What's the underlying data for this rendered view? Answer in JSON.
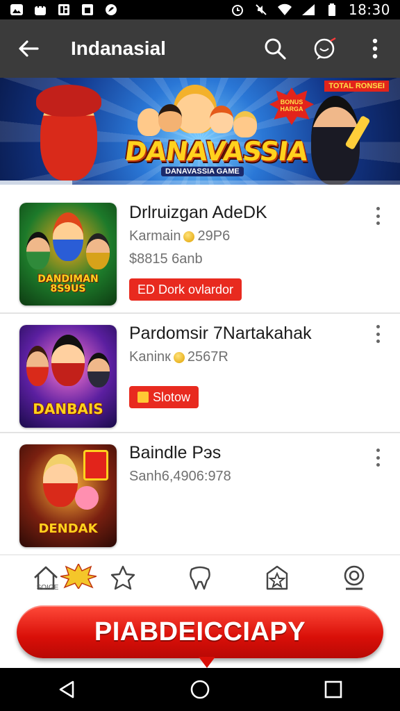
{
  "status_bar": {
    "time": "18:30",
    "left_icons": [
      "gallery-icon",
      "shopping-bag-icon",
      "news-icon",
      "app-icon",
      "leaf-icon"
    ],
    "right_icons": [
      "alarm-icon",
      "mute-icon",
      "wifi-icon",
      "signal-icon",
      "battery-icon"
    ]
  },
  "appbar": {
    "title": "Indanasial",
    "icons": [
      "back-arrow-icon",
      "search-icon",
      "chat-icon",
      "more-vert-icon"
    ]
  },
  "banner": {
    "logo": "DANAVASSIA",
    "subtitle": "DANAVASSIA GAME",
    "corner_tag": "TOTAL RONSEI",
    "burst_text": "BONUS HARGA",
    "progress": 0.18,
    "colors": {
      "sky": "#2a77d6",
      "logo": "#ffd21e"
    }
  },
  "games": [
    {
      "name": "Drlruizgan AdeDK",
      "meta": "Karmain",
      "meta_value": "29P6",
      "price": "$8815 6anb",
      "badge": "ED Dork ovlardor",
      "badge_icon": false,
      "thumb_caption": "DANDIMAN 8S9US",
      "thumb_bg": [
        "#1d7a2a",
        "#f2a51a",
        "#0e3b12"
      ]
    },
    {
      "name": "Pardomsir 7Nartakahak",
      "meta": "Kaninк",
      "meta_value": "2567R",
      "price": "",
      "badge": "Slotow",
      "badge_icon": true,
      "thumb_caption": "DANBAIS",
      "thumb_bg": [
        "#5b1fa0",
        "#ff7ad1",
        "#1a0b4a"
      ]
    },
    {
      "name": "Baindle Pэs",
      "meta": "Sanh6,4906:978",
      "meta_value": "",
      "price": "",
      "badge": "",
      "badge_icon": false,
      "thumb_caption": "DENDAK",
      "thumb_bg": [
        "#7a2010",
        "#ffb43a",
        "#2b0a06"
      ]
    }
  ],
  "tabs": [
    {
      "name": "home-icon",
      "mini": "SOIGE"
    },
    {
      "name": "star-person-icon",
      "mini": ""
    },
    {
      "name": "tooth-icon",
      "mini": ""
    },
    {
      "name": "star-box-icon",
      "mini": ""
    },
    {
      "name": "webcam-icon",
      "mini": ""
    }
  ],
  "cta": {
    "label": "PIABDEICCIAPY"
  },
  "navbar": {
    "icons": [
      "nav-back-icon",
      "nav-home-icon",
      "nav-recents-icon"
    ]
  }
}
